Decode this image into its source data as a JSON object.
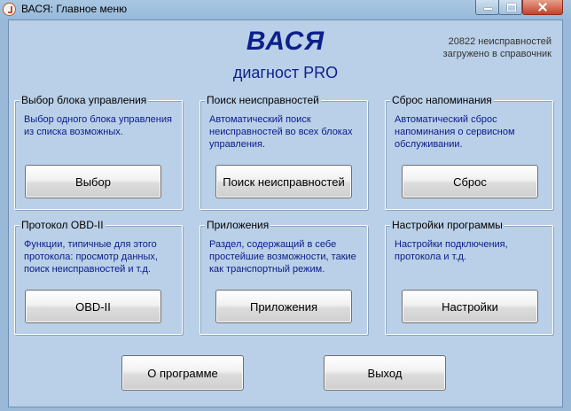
{
  "window": {
    "title": "ВАСЯ:  Главное меню"
  },
  "header": {
    "title": "ВАСЯ",
    "subtitle": "диагност PRO",
    "fault_count_line1": "20822 неисправностей",
    "fault_count_line2": "загружено в справочник"
  },
  "groups": [
    {
      "title": "Выбор блока управления",
      "description": "Выбор одного блока управления из списка возможных.",
      "button": "Выбор"
    },
    {
      "title": "Поиск неисправностей",
      "description": "Автоматический поиск неисправностей во всех блоках управления.",
      "button": "Поиск неисправностей"
    },
    {
      "title": "Сброс напоминания",
      "description": "Автоматический сброс напоминания о сервисном обслуживании.",
      "button": "Сброс"
    },
    {
      "title": "Протокол OBD-II",
      "description": "Функции, типичные для этого протокола: просмотр данных, поиск неисправностей и т.д.",
      "button": "OBD-II"
    },
    {
      "title": "Приложения",
      "description": "Раздел, содержащий в себе простейшие возможности, такие как транспортный режим.",
      "button": "Приложения"
    },
    {
      "title": "Настройки программы",
      "description": "Настройки подключения, протокола и т.д.",
      "button": "Настройки"
    }
  ],
  "footer": {
    "about_button": "О программе",
    "exit_button": "Выход"
  },
  "icons": {
    "app": "vasya-app-icon",
    "minimize": "minimize-icon",
    "maximize": "maximize-icon",
    "close": "close-icon"
  }
}
